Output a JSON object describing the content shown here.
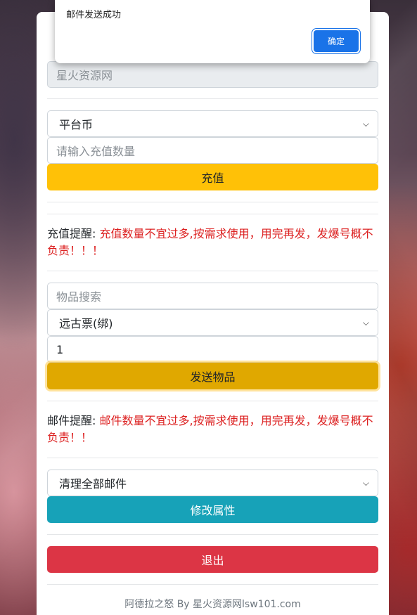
{
  "dialog": {
    "message": "邮件发送成功",
    "ok_label": "确定"
  },
  "server_field": {
    "value": "星火资源网"
  },
  "recharge": {
    "currency_select": "平台币",
    "amount_placeholder": "请输入充值数量",
    "button_label": "充值",
    "notice_label": "充值提醒: ",
    "notice_text": "充值数量不宜过多,按需求使用，用完再发，发爆号概不负责！！！"
  },
  "items": {
    "search_placeholder": "物品搜索",
    "item_select": "远古票(绑)",
    "quantity_value": "1",
    "send_label": "发送物品",
    "notice_label": "邮件提醒: ",
    "notice_text": "邮件数量不宜过多,按需求使用，用完再发，发爆号概不负责！！"
  },
  "mail": {
    "action_select": "清理全部邮件",
    "modify_label": "修改属性"
  },
  "logout_label": "退出",
  "footer_text": "阿德拉之怒 By 星火资源网lsw101.com",
  "icons": {
    "chevron": "chevron-down-icon"
  },
  "colors": {
    "warning": "#ffc107",
    "info": "#17a2b8",
    "danger": "#dc3545",
    "notice_red": "#dc1f1f",
    "dialog_button": "#1a73e8"
  }
}
